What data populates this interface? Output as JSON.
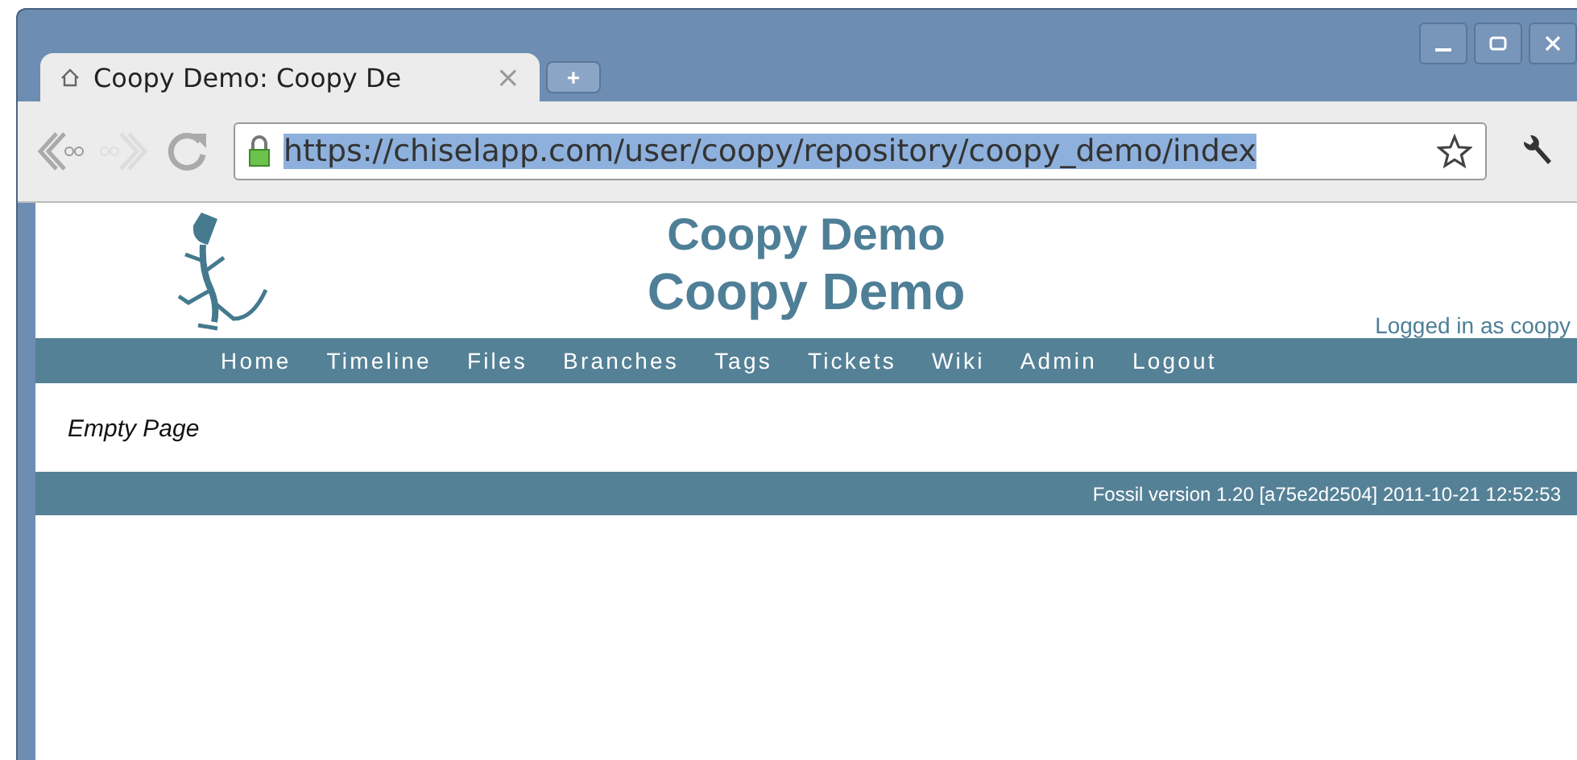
{
  "tab": {
    "title": "Coopy Demo: Coopy De",
    "close": "×",
    "new_tab": "+"
  },
  "address_bar": {
    "url": "https://chiselapp.com/user/coopy/repository/coopy_demo/index"
  },
  "page": {
    "title": "Coopy Demo",
    "subtitle": "Coopy Demo",
    "login": "Logged in as coopy",
    "nav": [
      {
        "label": "Home"
      },
      {
        "label": "Timeline"
      },
      {
        "label": "Files"
      },
      {
        "label": "Branches"
      },
      {
        "label": "Tags"
      },
      {
        "label": "Tickets"
      },
      {
        "label": "Wiki"
      },
      {
        "label": "Admin"
      },
      {
        "label": "Logout"
      }
    ],
    "content": "Empty Page",
    "footer": "Fossil version 1.20 [a75e2d2504] 2011-10-21 12:52:53"
  }
}
